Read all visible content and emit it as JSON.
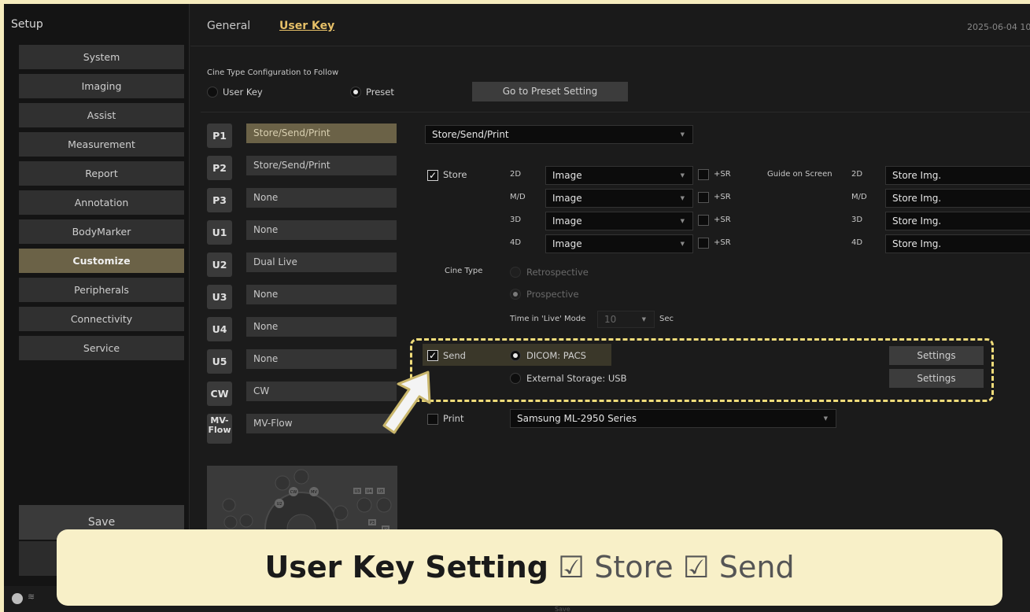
{
  "sidebar": {
    "title": "Setup",
    "items": [
      {
        "label": "System"
      },
      {
        "label": "Imaging"
      },
      {
        "label": "Assist"
      },
      {
        "label": "Measurement"
      },
      {
        "label": "Report"
      },
      {
        "label": "Annotation"
      },
      {
        "label": "BodyMarker"
      },
      {
        "label": "Customize",
        "active": true
      },
      {
        "label": "Peripherals"
      },
      {
        "label": "Connectivity"
      },
      {
        "label": "Service"
      }
    ],
    "save_label": "Save"
  },
  "tabs": [
    {
      "label": "General",
      "active": false
    },
    {
      "label": "User Key",
      "active": true
    }
  ],
  "datetime": "2025-06-04 10",
  "cine_config": {
    "title": "Cine Type Configuration to Follow",
    "options": [
      {
        "label": "User Key",
        "selected": false
      },
      {
        "label": "Preset",
        "selected": true
      }
    ],
    "preset_button": "Go to Preset Setting"
  },
  "user_keys": [
    {
      "key": "P1",
      "value": "Store/Send/Print",
      "active": true
    },
    {
      "key": "P2",
      "value": "Store/Send/Print"
    },
    {
      "key": "P3",
      "value": "None"
    },
    {
      "key": "U1",
      "value": "None"
    },
    {
      "key": "U2",
      "value": "Dual Live"
    },
    {
      "key": "U3",
      "value": "None"
    },
    {
      "key": "U4",
      "value": "None"
    },
    {
      "key": "U5",
      "value": "None"
    },
    {
      "key": "CW",
      "value": "CW"
    },
    {
      "key": "MV-\nFlow",
      "value": "MV-Flow"
    }
  ],
  "function_select": "Store/Send/Print",
  "store": {
    "label": "Store",
    "checked": true,
    "rows": [
      {
        "mode": "2D",
        "value": "Image",
        "sr": "+SR",
        "guide_mode": "2D",
        "guide_value": "Store Img."
      },
      {
        "mode": "M/D",
        "value": "Image",
        "sr": "+SR",
        "guide_mode": "M/D",
        "guide_value": "Store Img."
      },
      {
        "mode": "3D",
        "value": "Image",
        "sr": "+SR",
        "guide_mode": "3D",
        "guide_value": "Store Img."
      },
      {
        "mode": "4D",
        "value": "Image",
        "sr": "+SR",
        "guide_mode": "4D",
        "guide_value": "Store Img."
      }
    ],
    "guide_label": "Guide on Screen"
  },
  "cine_type": {
    "label": "Cine Type",
    "options": [
      {
        "label": "Retrospective",
        "selected": false
      },
      {
        "label": "Prospective",
        "selected": true
      }
    ],
    "time_label": "Time in 'Live' Mode",
    "time_value": "10",
    "time_unit": "Sec"
  },
  "send": {
    "label": "Send",
    "checked": true,
    "options": [
      {
        "label": "DICOM: PACS",
        "selected": true,
        "settings": "Settings"
      },
      {
        "label": "External Storage: USB",
        "selected": false,
        "settings": "Settings"
      }
    ]
  },
  "print": {
    "label": "Print",
    "checked": false,
    "printer": "Samsung ML-2950 Series"
  },
  "caption": {
    "strong": "User Key Setting",
    "rest": " ☑ Store ☑ Send"
  },
  "footer_save": "Save",
  "control_panel_labels": [
    "CW",
    "MV",
    "U2",
    "U3",
    "U4",
    "U5",
    "P3",
    "P2"
  ]
}
